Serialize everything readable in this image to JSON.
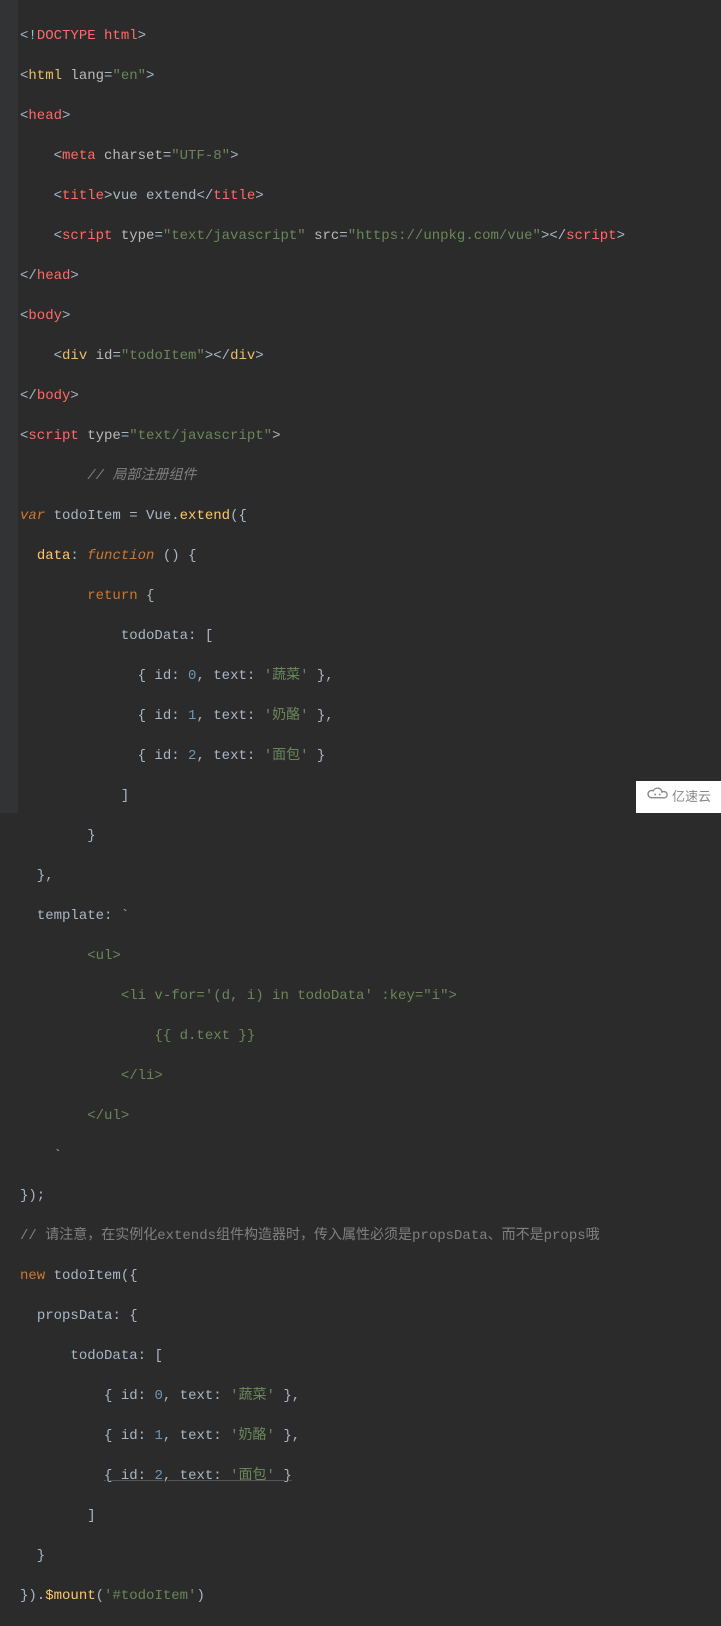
{
  "code": {
    "l1": {
      "a": "<!",
      "b": "DOCTYPE html",
      "c": ">"
    },
    "l2": {
      "a": "<",
      "b": "html ",
      "c": "lang",
      "d": "=",
      "e": "\"en\"",
      "f": ">"
    },
    "l3": {
      "a": "<",
      "b": "head",
      "c": ">"
    },
    "l4": {
      "a": "    <",
      "b": "meta ",
      "c": "charset",
      "d": "=",
      "e": "\"UTF-8\"",
      "f": ">"
    },
    "l5": {
      "a": "    <",
      "b": "title",
      "c": ">",
      "d": "vue extend",
      "e": "</",
      "f": "title",
      "g": ">"
    },
    "l6": {
      "a": "    <",
      "b": "script ",
      "c": "type",
      "d": "=",
      "e": "\"text/javascript\"",
      "f": " ",
      "g": "src",
      "h": "=",
      "i": "\"https://unpkg.com/vue\"",
      "j": "></",
      "k": "script",
      "l": ">"
    },
    "l7": {
      "a": "</",
      "b": "head",
      "c": ">"
    },
    "l8": {
      "a": "<",
      "b": "body",
      "c": ">"
    },
    "l9": {
      "a": "    <",
      "b": "div ",
      "c": "id",
      "d": "=",
      "e": "\"todoItem\"",
      "f": "></",
      "g": "div",
      "h": ">"
    },
    "l10": {
      "a": "</",
      "b": "body",
      "c": ">"
    },
    "l11": {
      "a": "<",
      "b": "script ",
      "c": "type",
      "d": "=",
      "e": "\"text/javascript\"",
      "f": ">"
    },
    "l12": {
      "a": "        // 局部注册组件"
    },
    "l13": {
      "a": "var ",
      "b": "todoItem = Vue.",
      "c": "extend",
      "d": "({"
    },
    "l14": {
      "a": "  ",
      "b": "data",
      "c": ": ",
      "d": "function ",
      "e": "() {"
    },
    "l15": {
      "a": "        ",
      "b": "return ",
      "c": "{"
    },
    "l16": {
      "a": "            ",
      "b": "todoData",
      "c": ": ["
    },
    "l17": {
      "a": "              { ",
      "b": "id",
      "c": ": ",
      "d": "0",
      "e": ", ",
      "f": "text",
      "g": ": ",
      "h": "'蔬菜' ",
      "i": "},"
    },
    "l18": {
      "a": "              { ",
      "b": "id",
      "c": ": ",
      "d": "1",
      "e": ", ",
      "f": "text",
      "g": ": ",
      "h": "'奶酪' ",
      "i": "},"
    },
    "l19": {
      "a": "              { ",
      "b": "id",
      "c": ": ",
      "d": "2",
      "e": ", ",
      "f": "text",
      "g": ": ",
      "h": "'面包' ",
      "i": "}"
    },
    "l20": {
      "a": "            ]"
    },
    "l21": {
      "a": "        }"
    },
    "l22": {
      "a": "  },"
    },
    "l23": {
      "a": "  ",
      "b": "template",
      "c": ": `"
    },
    "l24": {
      "a": "        <ul>"
    },
    "l25": {
      "a": "            <li v-for='(d, i) in todoData' :key=\"i\">"
    },
    "l26": {
      "a": "                {{ d.text }}"
    },
    "l27": {
      "a": "            </li>"
    },
    "l28": {
      "a": "        </ul>"
    },
    "l29": {
      "a": "    `"
    },
    "l30": {
      "a": "});"
    },
    "l31": {
      "a": "// 请注意，在实例化extends组件构造器时，传入属性必须是propsData、而不是props哦"
    },
    "l32": {
      "a": "new ",
      "b": "todoItem({"
    },
    "l33": {
      "a": "  ",
      "b": "propsData",
      "c": ": {"
    },
    "l34": {
      "a": "      ",
      "b": "todoData",
      "c": ": ["
    },
    "l35": {
      "a": "          { ",
      "b": "id",
      "c": ": ",
      "d": "0",
      "e": ", ",
      "f": "text",
      "g": ": ",
      "h": "'蔬菜' ",
      "i": "},"
    },
    "l36": {
      "a": "          { ",
      "b": "id",
      "c": ": ",
      "d": "1",
      "e": ", ",
      "f": "text",
      "g": ": ",
      "h": "'奶酪' ",
      "i": "},"
    },
    "l37": {
      "a": "          ",
      "b": "{ ",
      "c": "id",
      "d": ": ",
      "e": "2",
      "f": ", ",
      "g": "text",
      "h": ": ",
      "i": "'面包' ",
      "j": "}"
    },
    "l38": {
      "a": "        ]"
    },
    "l39": {
      "a": "  }"
    },
    "l40": {
      "a": "}).",
      "b": "$mount",
      "c": "(",
      "d": "'#todoItem'",
      "e": ")"
    }
  },
  "watermark": "亿速云"
}
